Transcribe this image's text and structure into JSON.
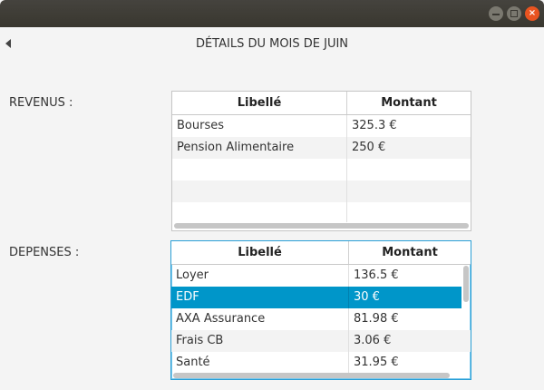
{
  "window": {
    "close_glyph": "×"
  },
  "header": {
    "back_icon": "back-arrow-icon",
    "title": "DÉTAILS DU MOIS DE JUIN"
  },
  "revenus": {
    "label": "REVENUS :",
    "columns": [
      "Libellé",
      "Montant"
    ],
    "rows": [
      {
        "libelle": "Bourses",
        "montant": "325.3 €"
      },
      {
        "libelle": "Pension Alimentaire",
        "montant": "250 €"
      }
    ]
  },
  "depenses": {
    "label": "DEPENSES :",
    "columns": [
      "Libellé",
      "Montant"
    ],
    "rows": [
      {
        "libelle": "Loyer",
        "montant": "136.5 €"
      },
      {
        "libelle": "EDF",
        "montant": "30 €"
      },
      {
        "libelle": "AXA Assurance",
        "montant": "81.98 €"
      },
      {
        "libelle": "Frais CB",
        "montant": "3.06 €"
      },
      {
        "libelle": "Santé",
        "montant": "31.95 €"
      }
    ],
    "selected_index": 1
  },
  "colors": {
    "selection": "#0096c9",
    "close_button": "#e95420",
    "focus_border": "#2a9fd6"
  }
}
